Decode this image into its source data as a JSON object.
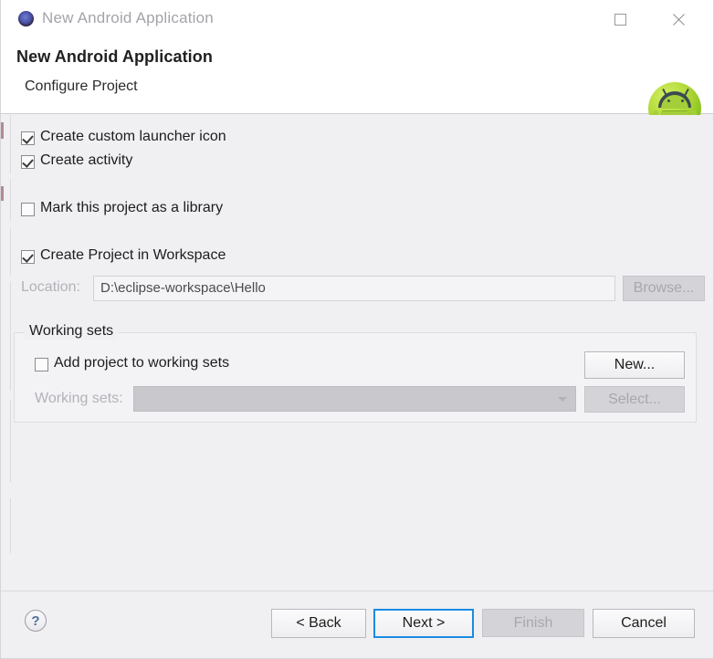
{
  "window": {
    "title": "New Android Application",
    "icon": "android-circle-icon",
    "controls": {
      "maximize": "maximize-icon",
      "close": "close-icon"
    }
  },
  "header": {
    "title": "New Android Application",
    "subtitle": "Configure Project",
    "logo": "android-robot-logo"
  },
  "options": {
    "create_launcher_icon": {
      "label": "Create custom launcher icon",
      "checked": true
    },
    "create_activity": {
      "label": "Create activity",
      "checked": true
    },
    "mark_as_library": {
      "label": "Mark this project as a library",
      "checked": false
    },
    "create_in_workspace": {
      "label": "Create Project in Workspace",
      "checked": true
    }
  },
  "location": {
    "label": "Location:",
    "value": "D:\\eclipse-workspace\\Hello",
    "placeholder": "",
    "enabled": false,
    "browse_label": "Browse...",
    "browse_enabled": false
  },
  "working_sets": {
    "group_label": "Working sets",
    "add_checkbox": {
      "label": "Add project to working sets",
      "checked": false
    },
    "combo_label": "Working sets:",
    "combo_value": "",
    "combo_enabled": false,
    "new_label": "New...",
    "new_enabled": true,
    "select_label": "Select...",
    "select_enabled": false
  },
  "footer": {
    "help_label": "?",
    "back_label": "< Back",
    "next_label": "Next >",
    "finish_label": "Finish",
    "cancel_label": "Cancel",
    "finish_enabled": false,
    "focused_button": "Next >"
  },
  "colors": {
    "dialog_background": "#f0eff2",
    "header_background": "#ffffff",
    "focus_accent": "#1b8ce0",
    "disabled_text": "#a9a7ad",
    "android_green": "#a4cf3a"
  }
}
